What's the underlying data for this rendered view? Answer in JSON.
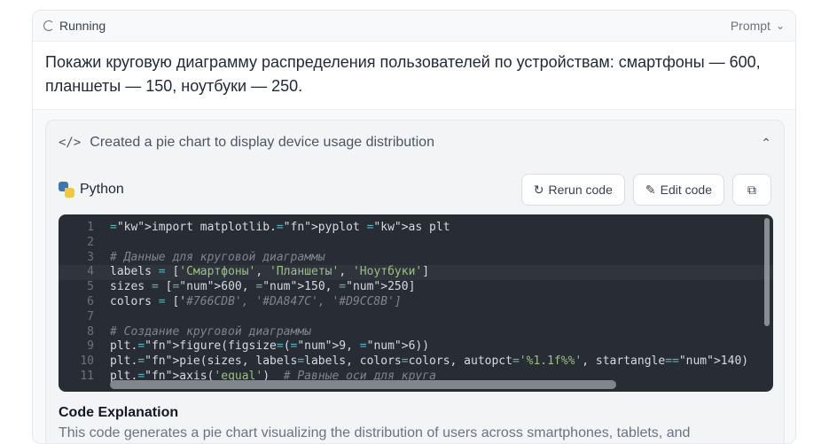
{
  "header": {
    "status_label": "Running",
    "prompt_toggle_label": "Prompt"
  },
  "prompt": {
    "text": "Покажи круговую диаграмму распределения пользователей по устройствам: смартфоны — 600, планшеты — 150, ноутбуки — 250."
  },
  "tool": {
    "title": "Created a pie chart to display device usage distribution",
    "language": "Python",
    "rerun_label": "Rerun code",
    "edit_label": "Edit code",
    "copy_icon": "copy-icon"
  },
  "code": {
    "active_line": 4,
    "lines": [
      "import matplotlib.pyplot as plt",
      "",
      "# Данные для круговой диаграммы",
      "labels = ['Смартфоны', 'Планшеты', 'Ноутбуки']",
      "sizes = [600, 150, 250]",
      "colors = ['#766CDB', '#DA847C', '#D9CC8B']",
      "",
      "# Создание круговой диаграммы",
      "plt.figure(figsize=(9, 6))",
      "plt.pie(sizes, labels=labels, colors=colors, autopct='%1.1f%%', startangle=140)",
      "plt.axis('equal')  # Равные оси для круга"
    ]
  },
  "explanation": {
    "title": "Code Explanation",
    "body": "This code generates a pie chart visualizing the distribution of users across smartphones, tablets, and"
  }
}
